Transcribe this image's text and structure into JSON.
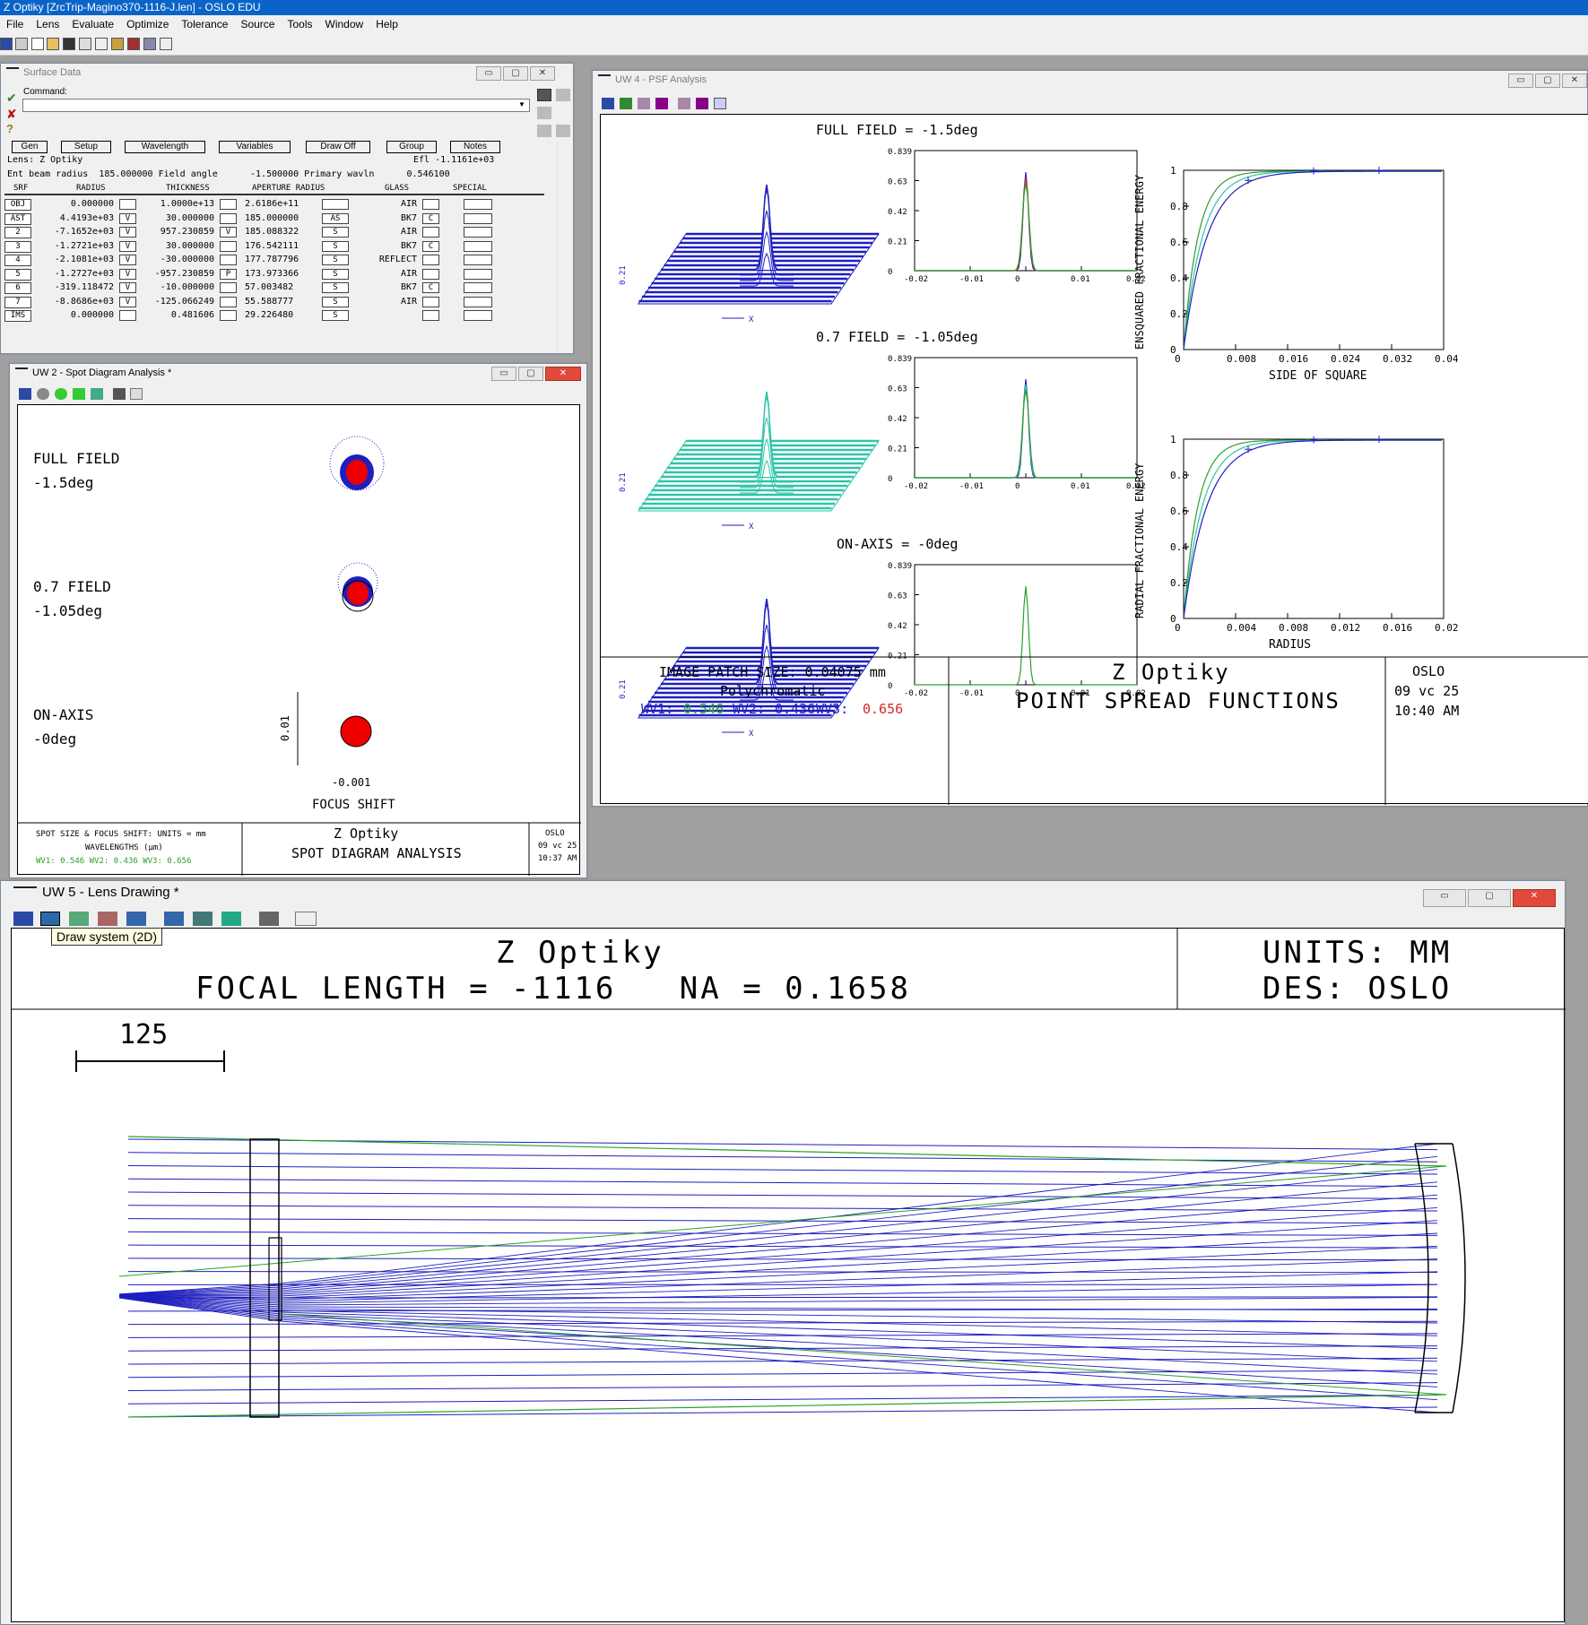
{
  "app": {
    "title": "Z Optiky [ZrcTrip-Magino370-1116-J.len] - OSLO EDU",
    "menu": [
      "File",
      "Lens",
      "Evaluate",
      "Optimize",
      "Tolerance",
      "Source",
      "Tools",
      "Window",
      "Help"
    ]
  },
  "window_buttons": {
    "minimize": "▭",
    "maximize": "▢",
    "close": "✕"
  },
  "surface_data": {
    "title": "Surface Data",
    "command_label": "Command:",
    "command_value": "",
    "tabs": [
      "Gen",
      "Setup",
      "Wavelength",
      "Variables",
      "Draw Off",
      "Group",
      "Notes"
    ],
    "lens_label": "Lens: Z Optiky",
    "efl_label": "Efl -1.1161e+03",
    "info_line": "Ent beam radius  185.000000 Field angle      -1.500000 Primary wavln      0.546100",
    "columns": [
      "SRF",
      "RADIUS",
      "THICKNESS",
      "APERTURE RADIUS",
      "GLASS",
      "SPECIAL"
    ],
    "rows": [
      {
        "srf": "OBJ",
        "radius": "0.000000",
        "rflag": "",
        "thickness": "1.0000e+13",
        "tflag": "",
        "aperture": "2.6186e+11",
        "aflag": "",
        "glass": "AIR",
        "gflag": ""
      },
      {
        "srf": "AST",
        "radius": "4.4193e+03",
        "rflag": "V",
        "thickness": "30.000000",
        "tflag": "",
        "aperture": "185.000000",
        "aflag": "AS",
        "glass": "BK7",
        "gflag": "C"
      },
      {
        "srf": "2",
        "radius": "-7.1652e+03",
        "rflag": "V",
        "thickness": "957.230859",
        "tflag": "V",
        "aperture": "185.088322",
        "aflag": "S",
        "glass": "AIR",
        "gflag": ""
      },
      {
        "srf": "3",
        "radius": "-1.2721e+03",
        "rflag": "V",
        "thickness": "30.000000",
        "tflag": "",
        "aperture": "176.542111",
        "aflag": "S",
        "glass": "BK7",
        "gflag": "C"
      },
      {
        "srf": "4",
        "radius": "-2.1081e+03",
        "rflag": "V",
        "thickness": "-30.000000",
        "tflag": "",
        "aperture": "177.787796",
        "aflag": "S",
        "glass": "REFLECT",
        "gflag": ""
      },
      {
        "srf": "5",
        "radius": "-1.2727e+03",
        "rflag": "V",
        "thickness": "-957.230859",
        "tflag": "P",
        "aperture": "173.973366",
        "aflag": "S",
        "glass": "AIR",
        "gflag": ""
      },
      {
        "srf": "6",
        "radius": "-319.118472",
        "rflag": "V",
        "thickness": "-10.000000",
        "tflag": "",
        "aperture": "57.003482",
        "aflag": "S",
        "glass": "BK7",
        "gflag": "C"
      },
      {
        "srf": "7",
        "radius": "-8.8686e+03",
        "rflag": "V",
        "thickness": "-125.066249",
        "tflag": "",
        "aperture": "55.588777",
        "aflag": "S",
        "glass": "AIR",
        "gflag": ""
      },
      {
        "srf": "IMS",
        "radius": "0.000000",
        "rflag": "",
        "thickness": "0.481606",
        "tflag": "",
        "aperture": "29.226480",
        "aflag": "S",
        "glass": "",
        "gflag": ""
      }
    ]
  },
  "spot": {
    "title": "UW 2 - Spot Diagram Analysis *",
    "field1": [
      "FULL FIELD",
      "-1.5deg"
    ],
    "field2": [
      "0.7 FIELD",
      "-1.05deg"
    ],
    "field3": [
      "ON-AXIS",
      "-0deg"
    ],
    "scale_label": "0.01",
    "focus_value": "-0.001",
    "focus_label": "FOCUS SHIFT",
    "footer_left1": "SPOT SIZE & FOCUS SHIFT: UNITS = mm",
    "footer_left2": "WAVELENGTHS (μm)",
    "footer_left3": "WV1: 0.546 WV2: 0.436 WV3: 0.656",
    "footer_mid1": "Z Optiky",
    "footer_mid2": "SPOT DIAGRAM ANALYSIS",
    "footer_right1": "OSLO",
    "footer_right2": "09 vc 25",
    "footer_right3": "10:37 AM"
  },
  "psf": {
    "title": "UW 4 - PSF Analysis",
    "row1_title": "FULL FIELD = -1.5deg",
    "row2_title": "0.7 FIELD = -1.05deg",
    "row3_title": "ON-AXIS = -0deg",
    "yticks": [
      "0.839",
      "0.63",
      "0.42",
      "0.21",
      "0"
    ],
    "xticks": [
      "-0.02",
      "-0.01",
      "0",
      "0.01",
      "0.02"
    ],
    "surf_scale": "0.21",
    "surf_axis": "X",
    "colors": {
      "wv1": "#2ca02c",
      "wv2": "#1f1fbf",
      "wv3": "#d62728"
    },
    "ens_ylabel": "ENSQUARED FRACTIONAL ENERGY",
    "ens_xlabel": "SIDE OF SQUARE",
    "ens_xticks": [
      "0",
      "0.008",
      "0.016",
      "0.024",
      "0.032",
      "0.04"
    ],
    "rad_ylabel": "RADIAL FRACTIONAL ENERGY",
    "rad_xlabel": "RADIUS",
    "rad_xticks": [
      "0",
      "0.004",
      "0.008",
      "0.012",
      "0.016",
      "0.02"
    ],
    "energy_yticks": [
      "1",
      "0.8",
      "0.6",
      "0.4",
      "0.2",
      "0"
    ],
    "footer_left1": "IMAGE PATCH SIZE: 0.04075 mm",
    "footer_left2": "Polychromatic",
    "wv_line": {
      "wv1_label": "WV1:",
      "wv1": "0.546",
      "wv2_label": "WV2:",
      "wv2": "0.436",
      "wv3_label": "WV3:",
      "wv3": "0.656"
    },
    "footer_mid1": "Z Optiky",
    "footer_mid2": "POINT SPREAD FUNCTIONS",
    "footer_right1": "OSLO",
    "footer_right2": "09 vc 25",
    "footer_right3": "10:40 AM"
  },
  "lens": {
    "title": "UW 5 - Lens Drawing *",
    "tooltip": "Draw system (2D)",
    "header_title": "Z Optiky",
    "header_sub": "FOCAL LENGTH = -1116   NA = 0.1658",
    "units": "UNITS: MM",
    "des": "DES: OSLO",
    "scale_label": "125"
  }
}
